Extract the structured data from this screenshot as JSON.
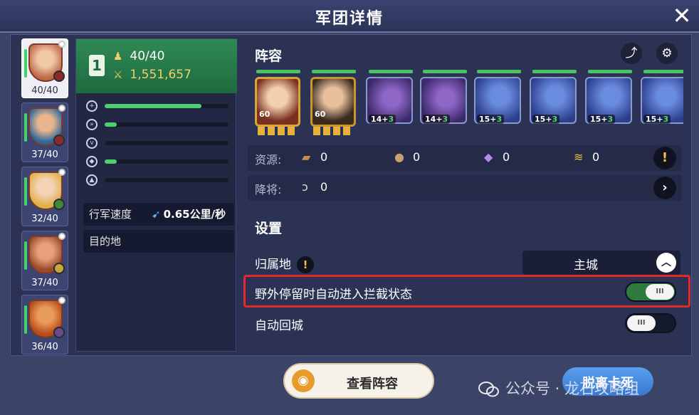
{
  "header": {
    "title": "军团详情",
    "close_icon": "close-icon"
  },
  "heroes": [
    {
      "count": "40/40",
      "selected": true
    },
    {
      "count": "37/40",
      "selected": false
    },
    {
      "count": "32/40",
      "selected": false
    },
    {
      "count": "37/40",
      "selected": false
    },
    {
      "count": "36/40",
      "selected": false
    }
  ],
  "troop": {
    "number": "1",
    "count": "40/40",
    "power": "1,551,657",
    "stat_levels": [
      0.78,
      0.1,
      0.0,
      0.1,
      0.0
    ],
    "march_speed_label": "行军速度",
    "march_speed_value": "0.65公里/秒",
    "destination_label": "目的地"
  },
  "lineup": {
    "title": "阵容",
    "units": [
      {
        "kind": "hero",
        "level": "60"
      },
      {
        "kind": "hero",
        "level": "60"
      },
      {
        "kind": "creature",
        "base": "14+",
        "plus": "3"
      },
      {
        "kind": "creature",
        "base": "14+",
        "plus": "3"
      },
      {
        "kind": "creature",
        "base": "15+",
        "plus": "3"
      },
      {
        "kind": "creature",
        "base": "15+",
        "plus": "3"
      },
      {
        "kind": "creature",
        "base": "15+",
        "plus": "3"
      },
      {
        "kind": "creature",
        "base": "15+",
        "plus": "3"
      }
    ]
  },
  "resources": {
    "label": "资源:",
    "items": [
      {
        "icon": "wood-icon",
        "value": "0"
      },
      {
        "icon": "stone-icon",
        "value": "0"
      },
      {
        "icon": "crystal-icon",
        "value": "0"
      },
      {
        "icon": "gold-icon",
        "value": "0"
      }
    ]
  },
  "captives": {
    "label": "降将:",
    "value": "0"
  },
  "settings": {
    "title": "设置",
    "home_label": "归属地",
    "home_value": "主城",
    "intercept_label": "野外停留时自动进入拦截状态",
    "intercept_on": true,
    "auto_return_label": "自动回城",
    "auto_return_on": false
  },
  "footer": {
    "view_lineup": "查看阵容",
    "leave": "脱离卡死",
    "watermark": "公众号 · 龙石攻略组"
  },
  "colors": {
    "accent_green": "#45d16a",
    "highlight_red": "#e02a2a"
  }
}
